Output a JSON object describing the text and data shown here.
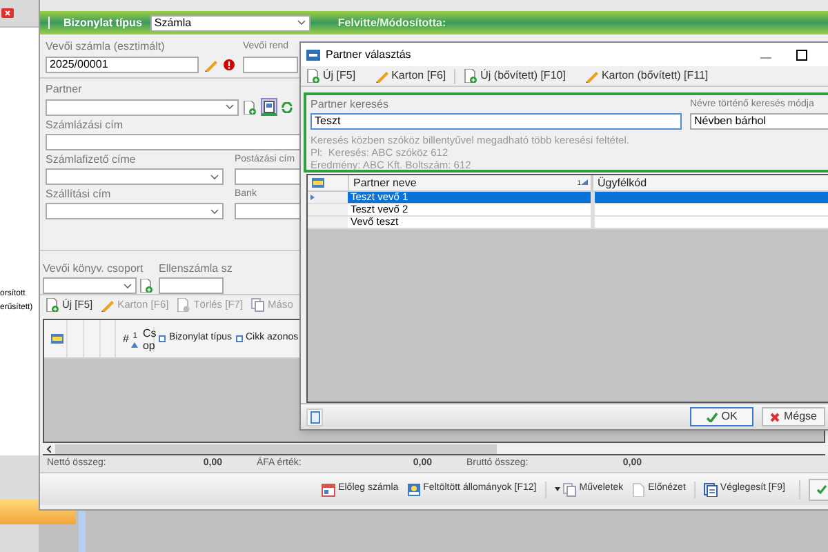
{
  "background_app": {
    "labels": [
      "orsított",
      "erűsített)"
    ]
  },
  "main_window": {
    "header": {
      "doc_type_label": "Bizonylat típus",
      "doc_type_value": "Számla",
      "modified_by_label": "Felvitte/Módosította:"
    },
    "invoice_no": {
      "label": "Vevői számla (esztimált)",
      "value": "2025/00001"
    },
    "order_label": "Vevői rend",
    "partner": {
      "label": "Partner"
    },
    "billing_address": {
      "label": "Számlázási cím"
    },
    "payer_address": {
      "label": "Számlafizető címe"
    },
    "postal_address": {
      "label": "Postázási cím"
    },
    "shipping_address": {
      "label": "Szállítási cím"
    },
    "bank": {
      "label": "Bank"
    },
    "ledger_group": {
      "label": "Vevői könyv. csoport"
    },
    "counter_account": {
      "label": "Ellenszámla sz"
    },
    "toolbar": [
      {
        "label": "Új [F5]",
        "kind": "add",
        "disabled": false
      },
      {
        "label": "Karton [F6]",
        "kind": "pencil",
        "disabled": true
      },
      {
        "label": "Törlés [F7]",
        "kind": "delete",
        "disabled": true
      },
      {
        "label": "Máso",
        "kind": "copy",
        "disabled": true
      }
    ],
    "grid": {
      "sort_index": "1",
      "columns": [
        {
          "label": "#",
          "kind": "plain"
        },
        {
          "label": "Cs op",
          "kind": "sort"
        },
        {
          "label": "Bizonylat típus",
          "kind": "check"
        },
        {
          "label": "Cikk azonos",
          "kind": "check"
        }
      ]
    },
    "totals": [
      {
        "label": "Nettó összeg:",
        "value": "0,00"
      },
      {
        "label": "ÁFA érték:",
        "value": "0,00"
      },
      {
        "label": "Bruttó összeg:",
        "value": "0,00"
      }
    ],
    "actions": [
      {
        "label": "Előleg számla",
        "kind": "calendar",
        "dropdown": false
      },
      {
        "label": "Feltöltött állományok [F12]",
        "kind": "picture",
        "dropdown": false
      },
      {
        "label": "Műveletek",
        "kind": "copy",
        "dropdown": true
      },
      {
        "label": "Előnézet",
        "kind": "page",
        "dropdown": false
      },
      {
        "label": "Véglegesít [F9]",
        "kind": "finalize",
        "dropdown": false
      }
    ]
  },
  "dialog": {
    "title": "Partner választás",
    "toolbar": [
      {
        "label": "Új [F5]",
        "kind": "add"
      },
      {
        "label": "Karton [F6]",
        "kind": "pencil"
      },
      {
        "label": "Új (bővített) [F10]",
        "kind": "add"
      },
      {
        "label": "Karton (bővített) [F11]",
        "kind": "pencil"
      }
    ],
    "search": {
      "label": "Partner keresés",
      "value": "Teszt",
      "mode_label": "Névre történő keresés módja",
      "mode_value": "Névben bárhol",
      "hints": [
        "Keresés közben szóköz billentyűvel megadható több keresési feltétel.",
        "Pl:  Keresés: ABC szóköz 612",
        "Eredmény: ABC Kft. Boltszám: 612"
      ]
    },
    "grid": {
      "sort_index": "1",
      "columns": [
        "Partner neve",
        "Ügyfélkód"
      ],
      "rows": [
        {
          "name": "Teszt vevő 1",
          "selected": true
        },
        {
          "name": "Teszt vevő 2",
          "selected": false
        },
        {
          "name": "Vevő teszt",
          "selected": false
        }
      ]
    },
    "buttons": [
      {
        "label": "OK",
        "kind": "ok"
      },
      {
        "label": "Mégse",
        "kind": "cancel"
      }
    ]
  }
}
